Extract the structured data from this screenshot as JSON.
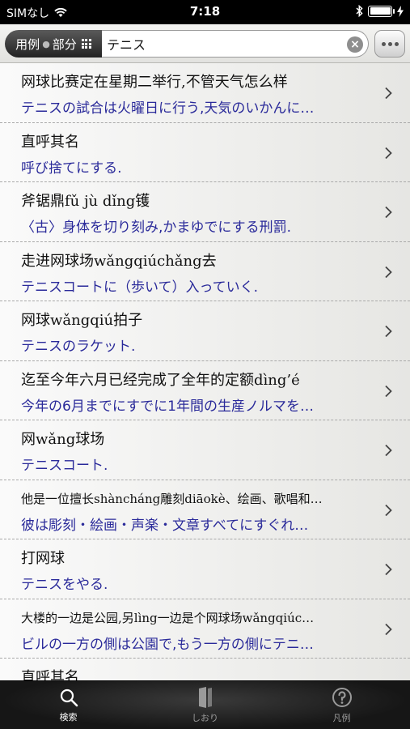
{
  "status_bar": {
    "carrier": "SIMなし",
    "time": "7:18",
    "bluetooth": "bluetooth-icon",
    "battery_level": 1.0
  },
  "search": {
    "scope_label_1": "用例",
    "scope_label_2": "部分",
    "query": "テニス"
  },
  "results": [
    {
      "zh": "网球比赛定在星期二举行,不管天气怎么样",
      "ja": "テニスの試合は火曜日に行う,天気のいかんに…"
    },
    {
      "zh": "直呼其名",
      "ja": "呼び捨てにする."
    },
    {
      "zh": "斧锯鼎fǔ jù dǐng镬",
      "ja": "〈古〉身体を切り刻み,かまゆでにする刑罰."
    },
    {
      "zh": "走进网球场wǎngqiúchǎng去",
      "ja": "テニスコートに（歩いて）入っていく."
    },
    {
      "zh": "网球wǎngqiú拍子",
      "ja": "テニスのラケット."
    },
    {
      "zh": "迄至今年六月已经完成了全年的定额dìng’é",
      "ja": "今年の6月までにすでに1年間の生産ノルマを…"
    },
    {
      "zh": "网wǎng球场",
      "ja": "テニスコート."
    },
    {
      "zh": "他是一位擅长shàncháng雕刻diāokè、绘画、歌唱和…",
      "ja": "彼は彫刻・絵画・声楽・文章すべてにすぐれ…"
    },
    {
      "zh": "打网球",
      "ja": "テニスをやる."
    },
    {
      "zh": "大楼的一边是公园,另lìng一边是个网球场wǎngqiúc…",
      "ja": "ビルの一方の側は公園で,もう一方の側にテニ…"
    },
    {
      "zh": "直呼其名",
      "ja": ""
    }
  ],
  "tabs": [
    {
      "label": "検索",
      "icon": "search-icon"
    },
    {
      "label": "しおり",
      "icon": "bookmark-icon"
    },
    {
      "label": "凡例",
      "icon": "help-icon"
    }
  ]
}
